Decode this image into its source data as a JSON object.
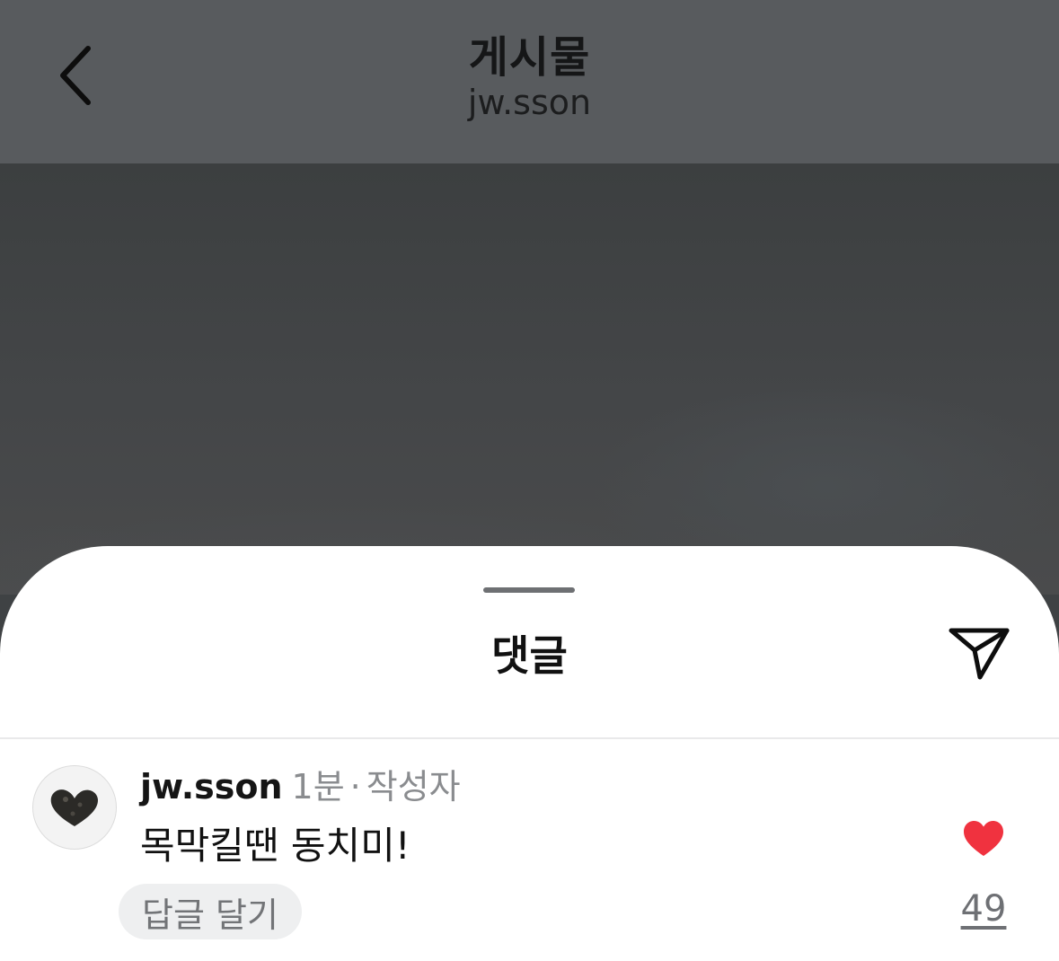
{
  "header": {
    "title": "게시물",
    "subtitle": "jw.sson",
    "back_icon": "chevron-left-icon"
  },
  "sheet": {
    "title": "댓글",
    "share_icon": "paper-plane-icon"
  },
  "comment": {
    "username": "jw.sson",
    "time": "1분",
    "separator": "·",
    "author_tag": "작성자",
    "text": "목막킬땐 동치미!",
    "reply_label": "답글 달기",
    "like_icon": "heart-icon",
    "like_count": "49",
    "liked": true
  },
  "colors": {
    "heart": "#f0323f",
    "header_bg": "#585b5e",
    "sheet_bg": "#ffffff"
  }
}
